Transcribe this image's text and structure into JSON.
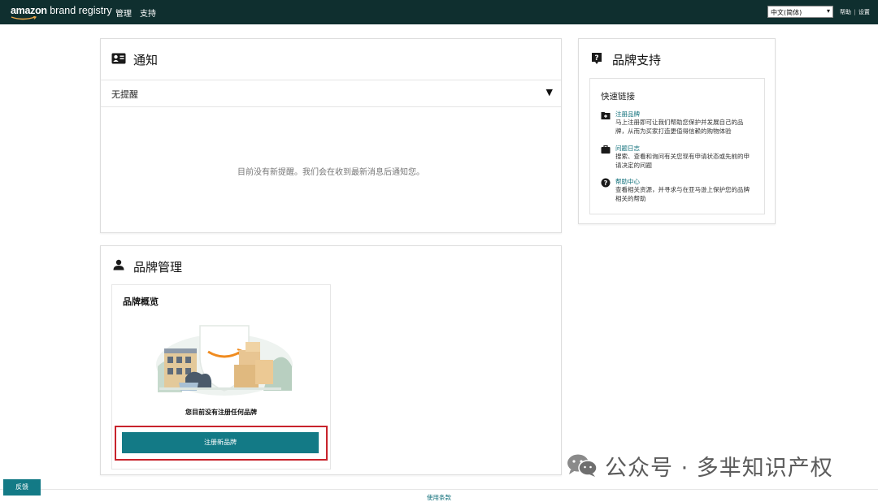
{
  "header": {
    "logo_brand": "amazon",
    "logo_product": "brand registry",
    "nav": [
      "管理",
      "支持"
    ],
    "language_selected": "中文(简体)",
    "help_label": "帮助",
    "separator": "|",
    "settings_label": "设置"
  },
  "notifications": {
    "title": "通知",
    "filter_label": "无提醒",
    "empty_message": "目前没有新提醒。我们会在收到最新消息后通知您。"
  },
  "support": {
    "title": "品牌支持",
    "quick_links_title": "快速链接",
    "items": [
      {
        "icon": "folder-plus-icon",
        "link": "注册品牌",
        "desc": "马上注册即可让我们帮助您保护并发展自己的品牌，从而为买家打造更值得信赖的购物体验"
      },
      {
        "icon": "briefcase-icon",
        "link": "问题日志",
        "desc": "搜索、查看和询问有关您现有申请状态或先前的申请决定的问题"
      },
      {
        "icon": "help-circle-icon",
        "link": "帮助中心",
        "desc": "查看相关资源，并寻求与在亚马逊上保护您的品牌相关的帮助"
      }
    ]
  },
  "brand_management": {
    "title": "品牌管理",
    "overview_title": "品牌概览",
    "no_brands_message": "您目前没有注册任何品牌",
    "register_button": "注册新品牌"
  },
  "footer": {
    "feedback_button": "反馈",
    "terms_link": "使用条款"
  },
  "watermark": {
    "text": "公众号 · 多芈知识产权"
  },
  "colors": {
    "topbar": "#0f2f2f",
    "accent": "#137a86",
    "highlight": "#c8232c"
  }
}
